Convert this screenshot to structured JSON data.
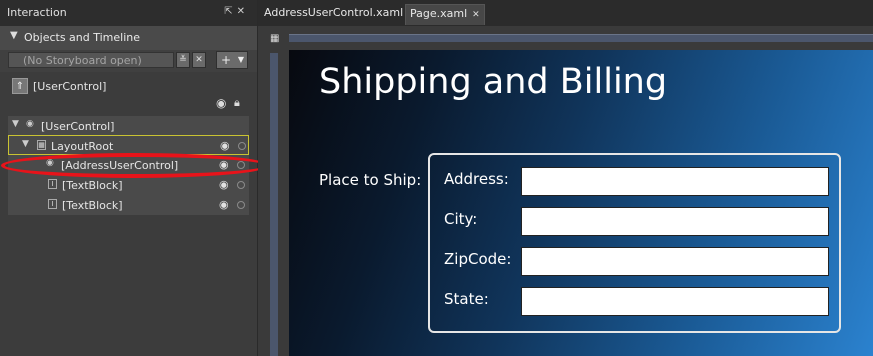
{
  "interaction_panel": {
    "title": "Interaction",
    "objects_timeline_title": "Objects and Timeline",
    "storyboard_placeholder": "(No Storyboard open)",
    "add_storyboard_label": "+",
    "scope_label": "[UserControl]"
  },
  "tree": {
    "items": [
      {
        "label": "[UserControl]"
      },
      {
        "label": "LayoutRoot"
      },
      {
        "label": "[AddressUserControl]"
      },
      {
        "label": "[TextBlock]"
      },
      {
        "label": "[TextBlock]"
      }
    ]
  },
  "tabs": [
    {
      "label": "AddressUserControl.xaml"
    },
    {
      "label": "Page.xaml"
    }
  ],
  "canvas": {
    "title": "Shipping and Billing",
    "place_label": "Place to Ship:",
    "fields": [
      {
        "label": "Address:",
        "value": ""
      },
      {
        "label": "City:",
        "value": ""
      },
      {
        "label": "ZipCode:",
        "value": ""
      },
      {
        "label": "State:",
        "value": ""
      }
    ]
  },
  "colors": {
    "highlight": "#e8131a",
    "selection_border": "#c9c332",
    "canvas_gradient_start": "#07090f",
    "canvas_gradient_end": "#2b82cf"
  },
  "icons": [
    "pin-icon",
    "close-icon",
    "eye-icon",
    "lock-icon",
    "user-control-icon",
    "grid-icon",
    "textblock-icon",
    "artboard-corner-icon"
  ]
}
